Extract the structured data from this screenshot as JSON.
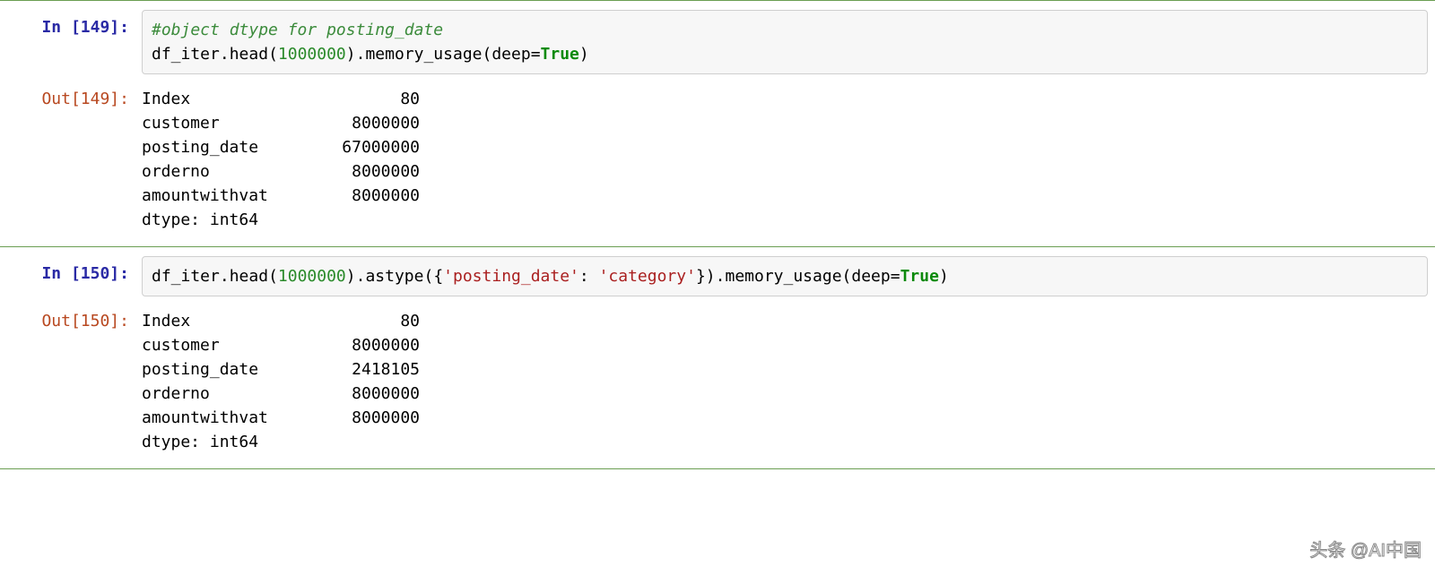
{
  "cells": [
    {
      "in_label": "In [149]:",
      "out_label": "Out[149]:",
      "code": {
        "comment": "#object dtype for posting_date",
        "nl": "\n",
        "t1": "df_iter",
        "t2": ".",
        "t3": "head",
        "t4": "(",
        "num1": "1000000",
        "t5": ")",
        "t6": ".",
        "t7": "memory_usage",
        "t8": "(",
        "t9": "deep",
        "t10": "=",
        "kw": "True",
        "t11": ")"
      },
      "output": {
        "rows": [
          {
            "label": "Index",
            "value": "80"
          },
          {
            "label": "customer",
            "value": "8000000"
          },
          {
            "label": "posting_date",
            "value": "67000000"
          },
          {
            "label": "orderno",
            "value": "8000000"
          },
          {
            "label": "amountwithvat",
            "value": "8000000"
          }
        ],
        "dtype": "dtype: int64"
      }
    },
    {
      "in_label": "In [150]:",
      "out_label": "Out[150]:",
      "code": {
        "t1": "df_iter",
        "t2": ".",
        "t3": "head",
        "t4": "(",
        "num1": "1000000",
        "t5": ")",
        "t6": ".",
        "t7": "astype",
        "t8": "({",
        "str1": "'posting_date'",
        "t9": ": ",
        "str2": "'category'",
        "t10": "})",
        "t11": ".",
        "t12": "memory_usage",
        "t13": "(",
        "t14": "deep",
        "t15": "=",
        "kw": "True",
        "t16": ")"
      },
      "output": {
        "rows": [
          {
            "label": "Index",
            "value": "80"
          },
          {
            "label": "customer",
            "value": "8000000"
          },
          {
            "label": "posting_date",
            "value": "2418105"
          },
          {
            "label": "orderno",
            "value": "8000000"
          },
          {
            "label": "amountwithvat",
            "value": "8000000"
          }
        ],
        "dtype": "dtype: int64"
      }
    }
  ],
  "watermark": "头条 @AI中国"
}
